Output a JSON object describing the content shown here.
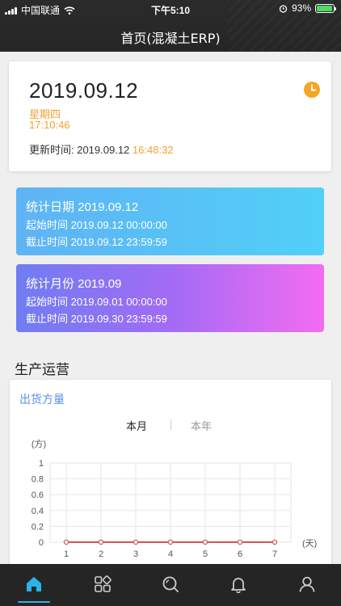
{
  "status_bar": {
    "carrier": "中国联通",
    "time": "下午5:10",
    "battery_pct": "93%",
    "battery_level": 0.93
  },
  "header": {
    "title": "首页(混凝土ERP)"
  },
  "date_card": {
    "date": "2019.09.12",
    "weekday": "星期四",
    "time": "17:10:46",
    "update_label": "更新时间: 2019.09.12",
    "update_time": "16:48:32",
    "icon": "clock-icon"
  },
  "stat_day": {
    "title": "统计日期 2019.09.12",
    "start": "起始时间 2019.09.12 00:00:00",
    "end": "截止时间 2019.09.12 23:59:59"
  },
  "stat_month": {
    "title": "统计月份 2019.09",
    "start": "起始时间 2019.09.01 00:00:00",
    "end": "截止时间 2019.09.30 23:59:59"
  },
  "section": {
    "title": "生产运营"
  },
  "shipment": {
    "title": "出货方量",
    "tabs": [
      "本月",
      "本年"
    ],
    "active_tab": "本月"
  },
  "chart_data": {
    "type": "line",
    "x": [
      1,
      2,
      3,
      4,
      5,
      6,
      7
    ],
    "series": [
      {
        "values": [
          0,
          0,
          0,
          0,
          0,
          0,
          0
        ],
        "color": "#d9534f"
      },
      {
        "values": [
          0,
          0,
          0,
          0,
          0,
          0,
          0
        ],
        "color": "#7b6cf2"
      }
    ],
    "y_ticks": [
      "1",
      "0.8",
      "0.6",
      "0.4",
      "0.2",
      "0"
    ],
    "ylim": [
      0,
      1
    ],
    "ylabel": "(方)",
    "xlabel": "(天)",
    "grid": true
  },
  "tabbar": {
    "items": [
      {
        "icon": "home-icon",
        "active": true
      },
      {
        "icon": "apps-icon",
        "active": false
      },
      {
        "icon": "search-icon",
        "active": false
      },
      {
        "icon": "bell-icon",
        "active": false
      },
      {
        "icon": "user-icon",
        "active": false
      }
    ],
    "active_color": "#2ab3e8",
    "inactive_color": "#cfcfcf"
  }
}
